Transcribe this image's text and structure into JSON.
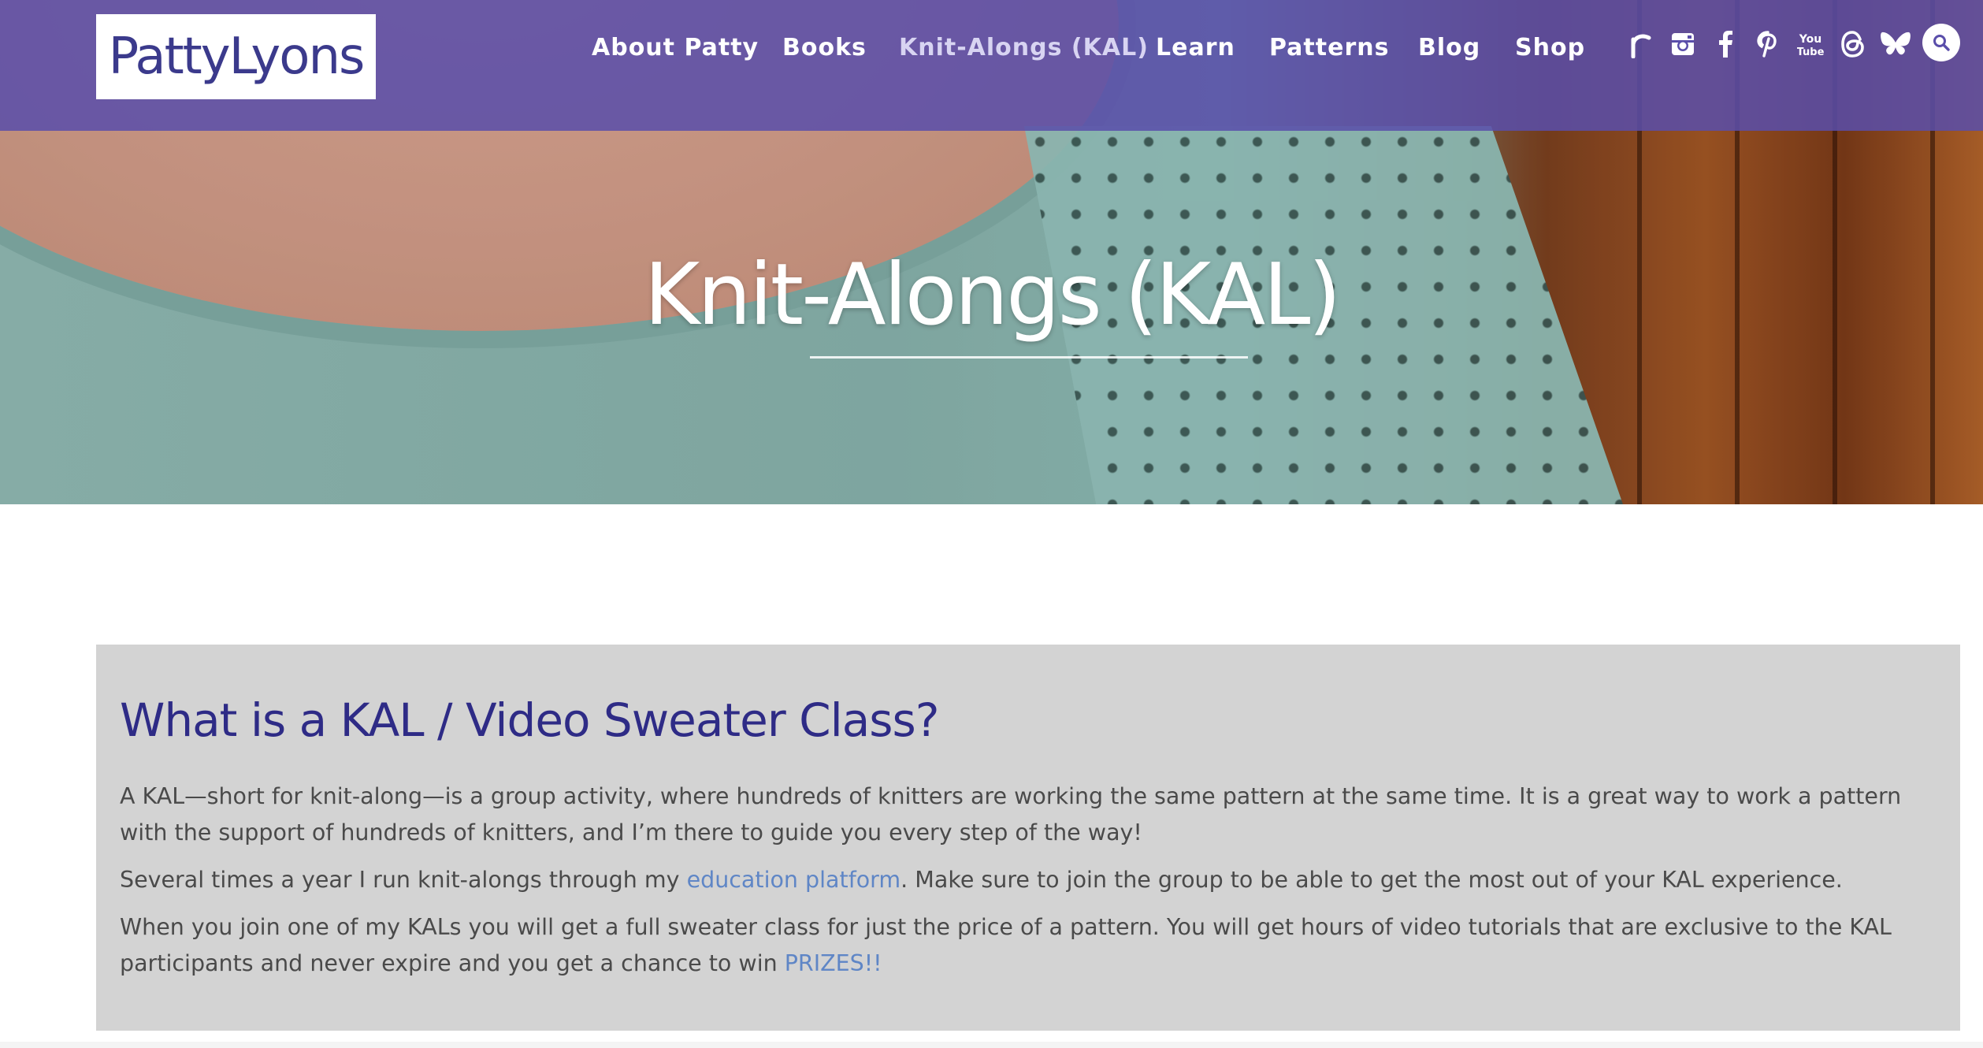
{
  "header": {
    "logo_text": "PattyLyons",
    "nav": [
      {
        "label": "About Patty",
        "active": false
      },
      {
        "label": "Books",
        "active": false
      },
      {
        "label": "Knit-Alongs (KAL)",
        "active": true
      },
      {
        "label": "Learn",
        "active": false
      },
      {
        "label": "Patterns",
        "active": false
      },
      {
        "label": "Blog",
        "active": false
      },
      {
        "label": "Shop",
        "active": false
      }
    ],
    "social_icons": [
      "ravelry-icon",
      "instagram-icon",
      "facebook-icon",
      "pinterest-icon",
      "youtube-icon",
      "threads-icon",
      "bluesky-icon"
    ],
    "youtube_text_top": "You",
    "youtube_text_bottom": "Tube",
    "search_icon": "search-icon",
    "colors": {
      "header_bg": "#5a4eaa",
      "accent_text": "#2e2b86",
      "link": "#5f86c6"
    }
  },
  "hero": {
    "title": "Knit-Alongs (KAL)"
  },
  "main": {
    "heading": "What is a KAL / Video Sweater Class?",
    "p1": "A KAL—short for knit-along—is a group activity, where hundreds of knitters are working the same pattern at the same time. It is a great way to work a pattern with the support of hundreds of knitters, and I’m there to guide you every step of the way!",
    "p2_before": "Several times a year I run knit-alongs through my ",
    "p2_link": "education platform",
    "p2_after": ". Make sure to join the group to be able to get the most out of your KAL experience.",
    "p3_before": "When you join one of my KALs you will get a full sweater class for just the price of a pattern. You will get hours of video tutorials that are exclusive to the KAL participants and never expire and you get a chance to win ",
    "p3_link": "PRIZES!!"
  }
}
